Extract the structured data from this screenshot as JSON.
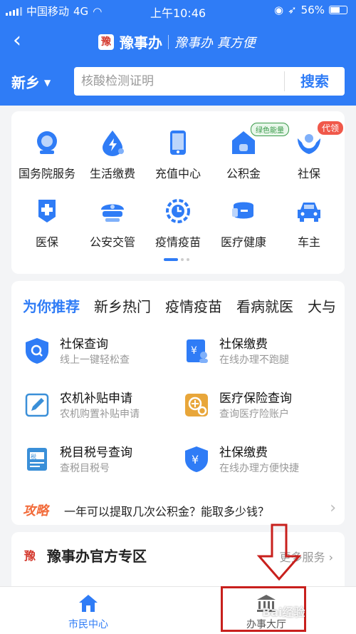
{
  "status": {
    "carrier": "中国移动",
    "network": "4G",
    "time": "上午10:46",
    "battery": "56%"
  },
  "nav": {
    "back": "‹",
    "app_name": "豫事办",
    "slogan": "豫事办 真方便",
    "logo_glyph": "豫"
  },
  "search": {
    "city": "新乡",
    "placeholder": "核酸检测证明",
    "button": "搜索"
  },
  "services": [
    {
      "label": "国务院服务",
      "icon": "state-council-icon"
    },
    {
      "label": "生活缴费",
      "icon": "utility-payment-icon"
    },
    {
      "label": "充值中心",
      "icon": "phone-recharge-icon"
    },
    {
      "label": "公积金",
      "icon": "housing-fund-icon",
      "badge": "绿色能量"
    },
    {
      "label": "社保",
      "icon": "social-security-icon",
      "badge": "代领"
    },
    {
      "label": "医保",
      "icon": "medical-insurance-icon"
    },
    {
      "label": "公安交管",
      "icon": "police-icon"
    },
    {
      "label": "疫情疫苗",
      "icon": "vaccine-icon"
    },
    {
      "label": "医疗健康",
      "icon": "health-icon"
    },
    {
      "label": "车主",
      "icon": "car-icon"
    }
  ],
  "recommend": {
    "tabs": [
      "为你推荐",
      "新乡热门",
      "疫情疫苗",
      "看病就医",
      "大与"
    ],
    "items": [
      {
        "title": "社保查询",
        "subtitle": "线上一键轻松查",
        "icon": "shield-search-icon"
      },
      {
        "title": "社保缴费",
        "subtitle": "在线办理不跑腿",
        "icon": "payment-person-icon"
      },
      {
        "title": "农机补贴申请",
        "subtitle": "农机购置补贴申请",
        "icon": "edit-form-icon"
      },
      {
        "title": "医疗保险查询",
        "subtitle": "查询医疗险账户",
        "icon": "medical-search-icon"
      },
      {
        "title": "税目税号查询",
        "subtitle": "查税目税号",
        "icon": "tax-doc-icon"
      },
      {
        "title": "社保缴费",
        "subtitle": "在线办理方便快捷",
        "icon": "yen-shield-icon"
      }
    ],
    "tip": {
      "label": "攻略",
      "text": "一年可以提取几次公积金？能取多少钱？",
      "arrow": "›"
    }
  },
  "zone": {
    "title": "豫事办官方专区",
    "more": "更多服务 ›",
    "logo_glyph": "豫"
  },
  "tabbar": [
    {
      "label": "市民中心",
      "icon": "home-icon"
    },
    {
      "label": "办事大厅",
      "icon": "hall-icon"
    }
  ],
  "watermark": "Bai经验",
  "colors": {
    "primary": "#2f7cf6",
    "annotation": "#c8201d",
    "tip": "#f26b3a"
  }
}
